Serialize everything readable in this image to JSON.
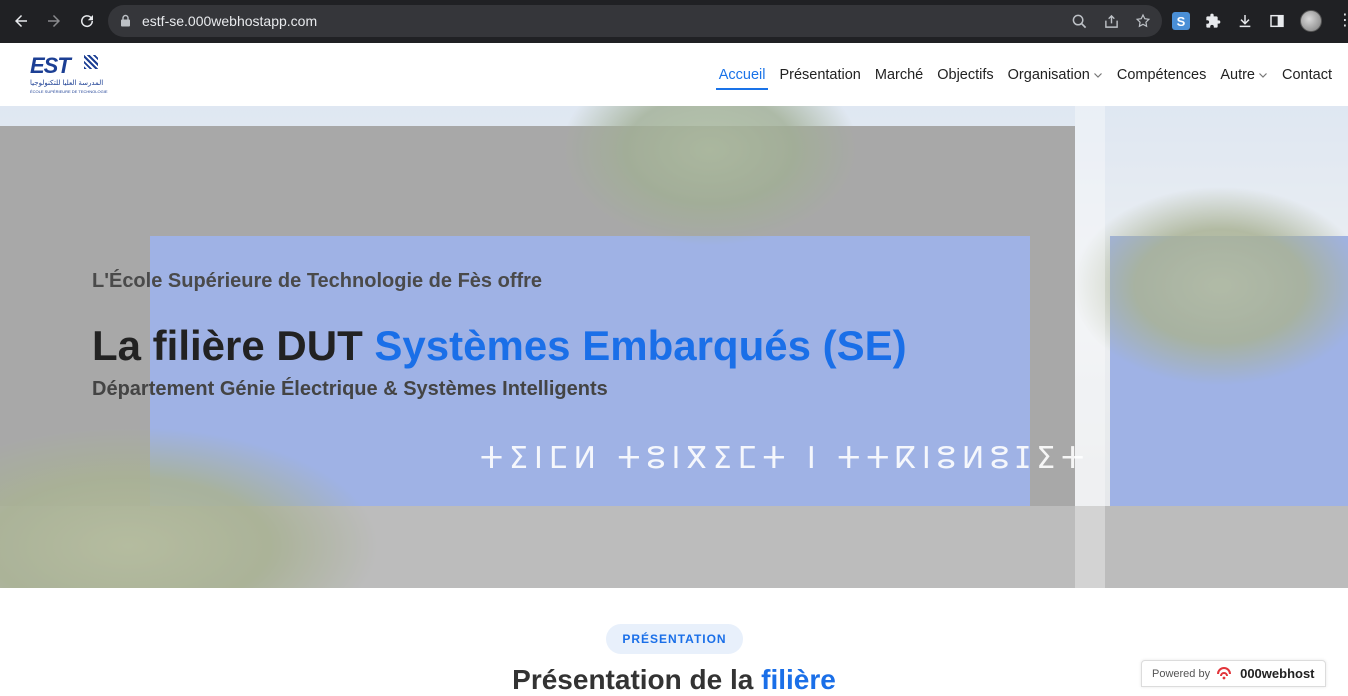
{
  "browser": {
    "url": "estf-se.000webhostapp.com"
  },
  "site": {
    "logo_text": "EST",
    "logo_arabic": "المدرسة العليا للتكنولوجيا",
    "logo_sub": "ÉCOLE SUPÉRIEURE DE TECHNOLOGIE",
    "nav": [
      {
        "label": "Accueil",
        "active": true,
        "dropdown": false
      },
      {
        "label": "Présentation",
        "active": false,
        "dropdown": false
      },
      {
        "label": "Marché",
        "active": false,
        "dropdown": false
      },
      {
        "label": "Objectifs",
        "active": false,
        "dropdown": false
      },
      {
        "label": "Organisation",
        "active": false,
        "dropdown": true
      },
      {
        "label": "Compétences",
        "active": false,
        "dropdown": false
      },
      {
        "label": "Autre",
        "active": false,
        "dropdown": true
      },
      {
        "label": "Contact",
        "active": false,
        "dropdown": false
      }
    ]
  },
  "hero": {
    "pretitle": "L'École Supérieure de Technologie de Fès offre",
    "title_prefix": "La filière DUT ",
    "title_highlight": "Systèmes Embarqués (SE)",
    "subtitle": "Département Génie Électrique & Systèmes Intelligents",
    "sign_tifinagh": "ⵜⵉⵏⵎⵍ ⵜⵓⵏⴳⵉⵎⵜ ⵏ ⵜⵜⴽⵏⵓⵍⵓⵊⵉⵜ"
  },
  "section": {
    "badge": "PRÉSENTATION",
    "title_prefix": "Présentation de la ",
    "title_highlight": "filière"
  },
  "footer_badge": {
    "powered_by": "Powered by",
    "brand": "000webhost"
  },
  "colors": {
    "accent": "#1a6fe8",
    "chrome_bg": "#202124",
    "omnibox_bg": "#35363a"
  }
}
